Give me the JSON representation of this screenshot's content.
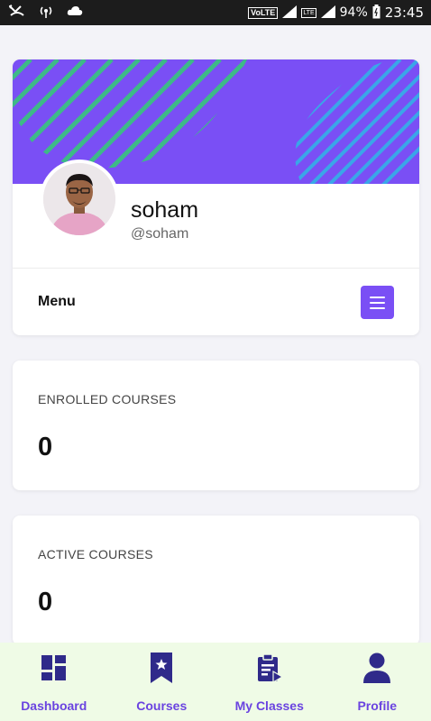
{
  "status_bar": {
    "volte": "VoLTE",
    "lte": "LTE",
    "battery": "94%",
    "time": "23:45"
  },
  "profile": {
    "name": "soham",
    "handle": "@soham",
    "menu_label": "Menu"
  },
  "stats": {
    "enrolled_title": "ENROLLED COURSES",
    "enrolled_value": "0",
    "active_title": "ACTIVE COURSES",
    "active_value": "0"
  },
  "nav": {
    "dashboard": "Dashboard",
    "courses": "Courses",
    "my_classes": "My Classes",
    "profile": "Profile"
  },
  "colors": {
    "accent": "#7a4ff5",
    "nav_icon": "#2f2a8a",
    "nav_label": "#6a43e0",
    "nav_bg": "#effbe6"
  }
}
